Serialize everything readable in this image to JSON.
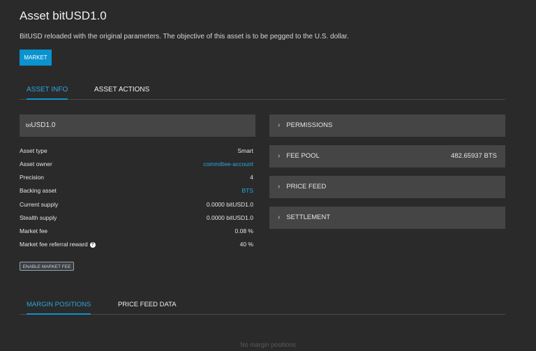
{
  "header": {
    "title": "Asset bitUSD1.0",
    "description": "BitUSD reloaded with the original parameters. The objective of this asset is to be pegged to the U.S. dollar.",
    "market_button": "MARKET"
  },
  "tabs": [
    {
      "label": "ASSET INFO",
      "active": true
    },
    {
      "label": "ASSET ACTIONS",
      "active": false
    }
  ],
  "asset_box": {
    "prefix": "bit",
    "name": "USD1.0"
  },
  "info": [
    {
      "label": "Asset type",
      "value": "Smart"
    },
    {
      "label": "Asset owner",
      "value": "committee-account"
    },
    {
      "label": "Precision",
      "value": "4"
    },
    {
      "label": "Backing asset",
      "value": "BTS"
    },
    {
      "label": "Current supply",
      "value": "0.0000 bitUSD1.0"
    },
    {
      "label": "Stealth supply",
      "value": "0.0000 bitUSD1.0"
    },
    {
      "label": "Market fee",
      "value": "0.08 %"
    },
    {
      "label": "Market fee referral reward",
      "value": "40 %"
    }
  ],
  "enable_fee_button": "ENABLE MARKET FEE",
  "panels": [
    {
      "label": "PERMISSIONS",
      "value": ""
    },
    {
      "label": "FEE POOL",
      "value": "482.65937 BTS"
    },
    {
      "label": "PRICE FEED",
      "value": ""
    },
    {
      "label": "SETTLEMENT",
      "value": ""
    }
  ],
  "bottom_tabs": [
    {
      "label": "MARGIN POSITIONS",
      "active": true
    },
    {
      "label": "PRICE FEED DATA",
      "active": false
    }
  ],
  "empty_message": "No margin positions",
  "colors": {
    "accent": "#0b93cf",
    "link": "#2aa7e0",
    "background": "#2a2a2a",
    "panel": "#454545"
  },
  "icons": {
    "panel_expand": "chevron-right-icon",
    "help": "help-circle-icon"
  }
}
